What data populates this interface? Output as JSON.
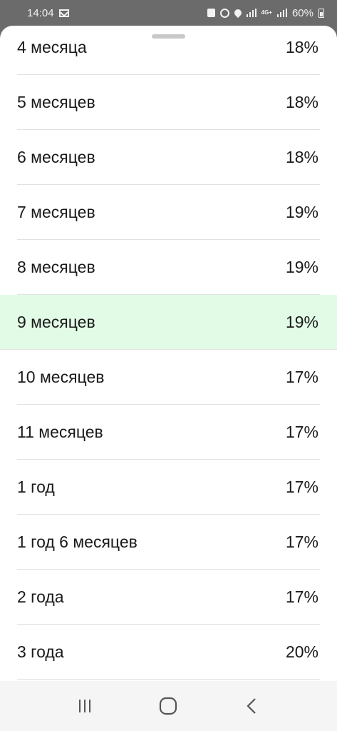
{
  "status_bar": {
    "time": "14:04",
    "network_label": "4G+",
    "battery": "60%"
  },
  "icons": {
    "gmail": "gmail-icon",
    "lock": "lock-icon",
    "alarm": "alarm-icon",
    "location": "location-icon",
    "signal": "signal-icon",
    "battery": "battery-icon",
    "recent_apps": "recent-apps-icon",
    "home": "home-icon",
    "back": "back-icon"
  },
  "colors": {
    "selected_row_bg": "#e2fbe6",
    "divider": "#e2e2e2"
  },
  "selected_index": 5,
  "rows": [
    {
      "term": "4 месяца",
      "rate": "18%"
    },
    {
      "term": "5 месяцев",
      "rate": "18%"
    },
    {
      "term": "6 месяцев",
      "rate": "18%"
    },
    {
      "term": "7 месяцев",
      "rate": "19%"
    },
    {
      "term": "8 месяцев",
      "rate": "19%"
    },
    {
      "term": "9 месяцев",
      "rate": "19%"
    },
    {
      "term": "10 месяцев",
      "rate": "17%"
    },
    {
      "term": "11 месяцев",
      "rate": "17%"
    },
    {
      "term": "1 год",
      "rate": "17%"
    },
    {
      "term": "1 год 6 месяцев",
      "rate": "17%"
    },
    {
      "term": "2 года",
      "rate": "17%"
    },
    {
      "term": "3 года",
      "rate": "20%"
    }
  ]
}
